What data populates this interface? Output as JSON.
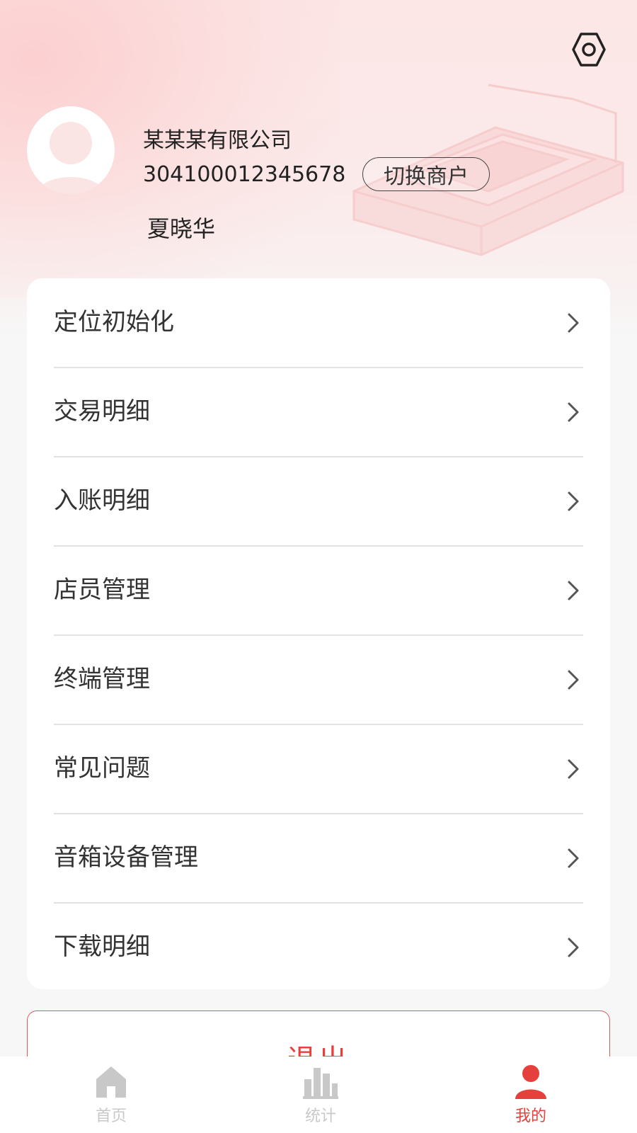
{
  "header": {
    "company_name": "某某某有限公司",
    "merchant_number": "304100012345678",
    "switch_merchant_label": "切换商户",
    "user_name": "夏晓华"
  },
  "menu": {
    "items": [
      {
        "label": "定位初始化"
      },
      {
        "label": "交易明细"
      },
      {
        "label": "入账明细"
      },
      {
        "label": "店员管理"
      },
      {
        "label": "终端管理"
      },
      {
        "label": "常见问题"
      },
      {
        "label": "音箱设备管理"
      },
      {
        "label": "下载明细"
      }
    ]
  },
  "logout": {
    "label": "退出"
  },
  "tabbar": {
    "tabs": [
      {
        "label": "首页",
        "icon": "home-icon",
        "active": false
      },
      {
        "label": "统计",
        "icon": "stats-icon",
        "active": false
      },
      {
        "label": "我的",
        "icon": "profile-icon",
        "active": true
      }
    ]
  },
  "colors": {
    "accent": "#e5403b",
    "inactive": "#c8c8c8",
    "text": "#333333",
    "background": "#f7f7f7"
  }
}
